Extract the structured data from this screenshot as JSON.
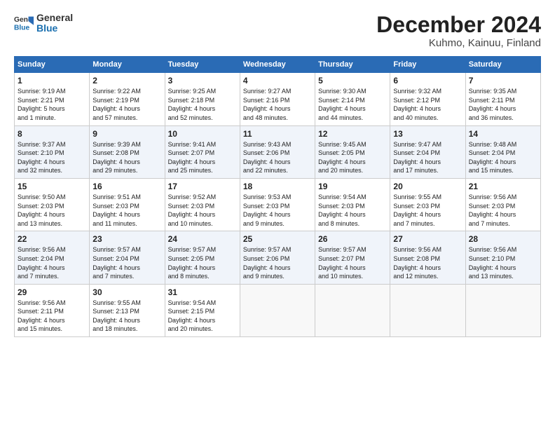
{
  "logo": {
    "line1": "General",
    "line2": "Blue"
  },
  "title": "December 2024",
  "subtitle": "Kuhmo, Kainuu, Finland",
  "days_header": [
    "Sunday",
    "Monday",
    "Tuesday",
    "Wednesday",
    "Thursday",
    "Friday",
    "Saturday"
  ],
  "weeks": [
    [
      {
        "day": "1",
        "info": "Sunrise: 9:19 AM\nSunset: 2:21 PM\nDaylight: 5 hours\nand 1 minute."
      },
      {
        "day": "2",
        "info": "Sunrise: 9:22 AM\nSunset: 2:19 PM\nDaylight: 4 hours\nand 57 minutes."
      },
      {
        "day": "3",
        "info": "Sunrise: 9:25 AM\nSunset: 2:18 PM\nDaylight: 4 hours\nand 52 minutes."
      },
      {
        "day": "4",
        "info": "Sunrise: 9:27 AM\nSunset: 2:16 PM\nDaylight: 4 hours\nand 48 minutes."
      },
      {
        "day": "5",
        "info": "Sunrise: 9:30 AM\nSunset: 2:14 PM\nDaylight: 4 hours\nand 44 minutes."
      },
      {
        "day": "6",
        "info": "Sunrise: 9:32 AM\nSunset: 2:12 PM\nDaylight: 4 hours\nand 40 minutes."
      },
      {
        "day": "7",
        "info": "Sunrise: 9:35 AM\nSunset: 2:11 PM\nDaylight: 4 hours\nand 36 minutes."
      }
    ],
    [
      {
        "day": "8",
        "info": "Sunrise: 9:37 AM\nSunset: 2:10 PM\nDaylight: 4 hours\nand 32 minutes."
      },
      {
        "day": "9",
        "info": "Sunrise: 9:39 AM\nSunset: 2:08 PM\nDaylight: 4 hours\nand 29 minutes."
      },
      {
        "day": "10",
        "info": "Sunrise: 9:41 AM\nSunset: 2:07 PM\nDaylight: 4 hours\nand 25 minutes."
      },
      {
        "day": "11",
        "info": "Sunrise: 9:43 AM\nSunset: 2:06 PM\nDaylight: 4 hours\nand 22 minutes."
      },
      {
        "day": "12",
        "info": "Sunrise: 9:45 AM\nSunset: 2:05 PM\nDaylight: 4 hours\nand 20 minutes."
      },
      {
        "day": "13",
        "info": "Sunrise: 9:47 AM\nSunset: 2:04 PM\nDaylight: 4 hours\nand 17 minutes."
      },
      {
        "day": "14",
        "info": "Sunrise: 9:48 AM\nSunset: 2:04 PM\nDaylight: 4 hours\nand 15 minutes."
      }
    ],
    [
      {
        "day": "15",
        "info": "Sunrise: 9:50 AM\nSunset: 2:03 PM\nDaylight: 4 hours\nand 13 minutes."
      },
      {
        "day": "16",
        "info": "Sunrise: 9:51 AM\nSunset: 2:03 PM\nDaylight: 4 hours\nand 11 minutes."
      },
      {
        "day": "17",
        "info": "Sunrise: 9:52 AM\nSunset: 2:03 PM\nDaylight: 4 hours\nand 10 minutes."
      },
      {
        "day": "18",
        "info": "Sunrise: 9:53 AM\nSunset: 2:03 PM\nDaylight: 4 hours\nand 9 minutes."
      },
      {
        "day": "19",
        "info": "Sunrise: 9:54 AM\nSunset: 2:03 PM\nDaylight: 4 hours\nand 8 minutes."
      },
      {
        "day": "20",
        "info": "Sunrise: 9:55 AM\nSunset: 2:03 PM\nDaylight: 4 hours\nand 7 minutes."
      },
      {
        "day": "21",
        "info": "Sunrise: 9:56 AM\nSunset: 2:03 PM\nDaylight: 4 hours\nand 7 minutes."
      }
    ],
    [
      {
        "day": "22",
        "info": "Sunrise: 9:56 AM\nSunset: 2:04 PM\nDaylight: 4 hours\nand 7 minutes."
      },
      {
        "day": "23",
        "info": "Sunrise: 9:57 AM\nSunset: 2:04 PM\nDaylight: 4 hours\nand 7 minutes."
      },
      {
        "day": "24",
        "info": "Sunrise: 9:57 AM\nSunset: 2:05 PM\nDaylight: 4 hours\nand 8 minutes."
      },
      {
        "day": "25",
        "info": "Sunrise: 9:57 AM\nSunset: 2:06 PM\nDaylight: 4 hours\nand 9 minutes."
      },
      {
        "day": "26",
        "info": "Sunrise: 9:57 AM\nSunset: 2:07 PM\nDaylight: 4 hours\nand 10 minutes."
      },
      {
        "day": "27",
        "info": "Sunrise: 9:56 AM\nSunset: 2:08 PM\nDaylight: 4 hours\nand 12 minutes."
      },
      {
        "day": "28",
        "info": "Sunrise: 9:56 AM\nSunset: 2:10 PM\nDaylight: 4 hours\nand 13 minutes."
      }
    ],
    [
      {
        "day": "29",
        "info": "Sunrise: 9:56 AM\nSunset: 2:11 PM\nDaylight: 4 hours\nand 15 minutes."
      },
      {
        "day": "30",
        "info": "Sunrise: 9:55 AM\nSunset: 2:13 PM\nDaylight: 4 hours\nand 18 minutes."
      },
      {
        "day": "31",
        "info": "Sunrise: 9:54 AM\nSunset: 2:15 PM\nDaylight: 4 hours\nand 20 minutes."
      },
      {
        "day": "",
        "info": ""
      },
      {
        "day": "",
        "info": ""
      },
      {
        "day": "",
        "info": ""
      },
      {
        "day": "",
        "info": ""
      }
    ]
  ]
}
